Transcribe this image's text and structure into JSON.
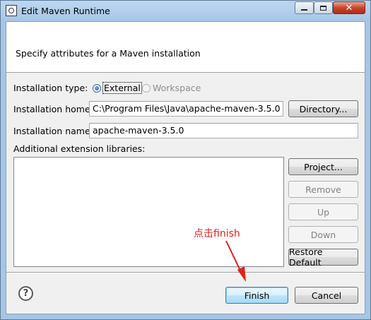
{
  "window": {
    "title": "Edit Maven Runtime",
    "close_glyph": "✕"
  },
  "banner": {
    "text": "Specify attributes for a Maven installation"
  },
  "installation_type": {
    "label": "Installation type:",
    "options": [
      {
        "label": "External",
        "selected": true,
        "enabled": true
      },
      {
        "label": "Workspace",
        "selected": false,
        "enabled": false
      }
    ]
  },
  "installation_home": {
    "label": "Installation home:",
    "value": "C:\\Program Files\\Java\\apache-maven-3.5.0",
    "button": "Directory..."
  },
  "installation_name": {
    "label": "Installation name:",
    "value": "apache-maven-3.5.0"
  },
  "extensions": {
    "label": "Additional extension libraries:",
    "buttons": {
      "project": "Project...",
      "remove": "Remove",
      "up": "Up",
      "down": "Down",
      "restore": "Restore Default"
    }
  },
  "footer": {
    "help_glyph": "?",
    "finish": "Finish",
    "cancel": "Cancel"
  },
  "annotation": {
    "text": "点击finish",
    "color": "#e0201a"
  }
}
